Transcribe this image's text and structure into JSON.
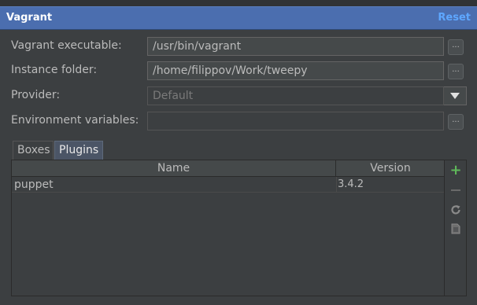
{
  "header": {
    "title": "Vagrant",
    "reset": "Reset"
  },
  "fields": {
    "executable": {
      "label": "Vagrant executable:",
      "value": "/usr/bin/vagrant"
    },
    "instance": {
      "label": "Instance folder:",
      "value": "/home/filippov/Work/tweepy"
    },
    "provider": {
      "label": "Provider:",
      "value": "Default"
    },
    "env": {
      "label": "Environment variables:",
      "value": ""
    }
  },
  "browse_label": "...",
  "tabs": [
    {
      "label": "Boxes"
    },
    {
      "label": "Plugins",
      "selected": true
    }
  ],
  "table": {
    "columns": [
      "Name",
      "Version"
    ],
    "rows": [
      {
        "name": "puppet",
        "version": "3.4.2"
      }
    ]
  },
  "colors": {
    "header": "#4b6eaf",
    "accent": "#5ea7ff",
    "add": "#5fb85a"
  },
  "icons": [
    "add-icon",
    "remove-icon",
    "refresh-icon",
    "document-icon",
    "chevron-down-icon"
  ]
}
